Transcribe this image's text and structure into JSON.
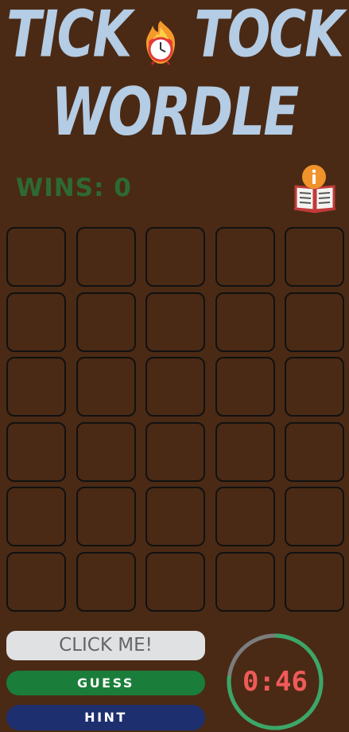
{
  "title": {
    "word1": "TICK",
    "word2": "TOCK",
    "word3": "WORDLE",
    "clock_icon": "alarm-clock-fire-emoji"
  },
  "wins": {
    "label": "WINS: 0",
    "count": 0
  },
  "info": {
    "icon": "open-book-info-icon"
  },
  "board": {
    "rows": 6,
    "cols": 5
  },
  "buttons": {
    "click_me": "CLICK ME!",
    "guess": "GUESS",
    "hint": "HINT"
  },
  "timer": {
    "display": "0:46",
    "remaining_fraction": 0.77
  },
  "colors": {
    "background": "#4a2a15",
    "title": "#b4cce4",
    "wins": "#2d6a32",
    "guess": "#1b7d3a",
    "hint": "#1d2f6f",
    "timer_progress": "#3aa768",
    "timer_track": "#7c7c7c",
    "timer_text": "#f05a5a"
  }
}
